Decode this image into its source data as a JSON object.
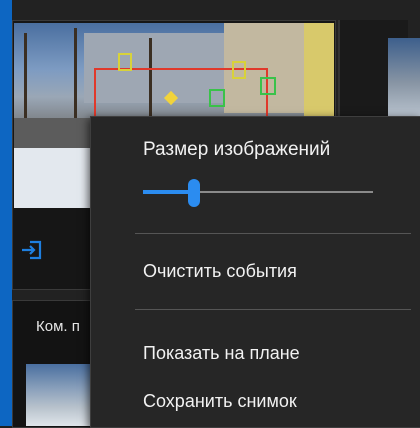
{
  "background": {
    "bottom_card_label": "Ком. п"
  },
  "icons": {
    "login": "login-icon"
  },
  "menu": {
    "heading": "Размер изображений",
    "image_size_slider": {
      "value_fraction": 0.22
    },
    "items": [
      {
        "label": "Очистить события"
      },
      {
        "label": "Показать на плане"
      },
      {
        "label": "Сохранить снимок"
      }
    ]
  },
  "colors": {
    "accent": "#2b8cf0",
    "menu_bg": "#262626",
    "detection_red": "#e0392b",
    "detection_yellow": "#d8d23a",
    "detection_green": "#3ac24a"
  }
}
